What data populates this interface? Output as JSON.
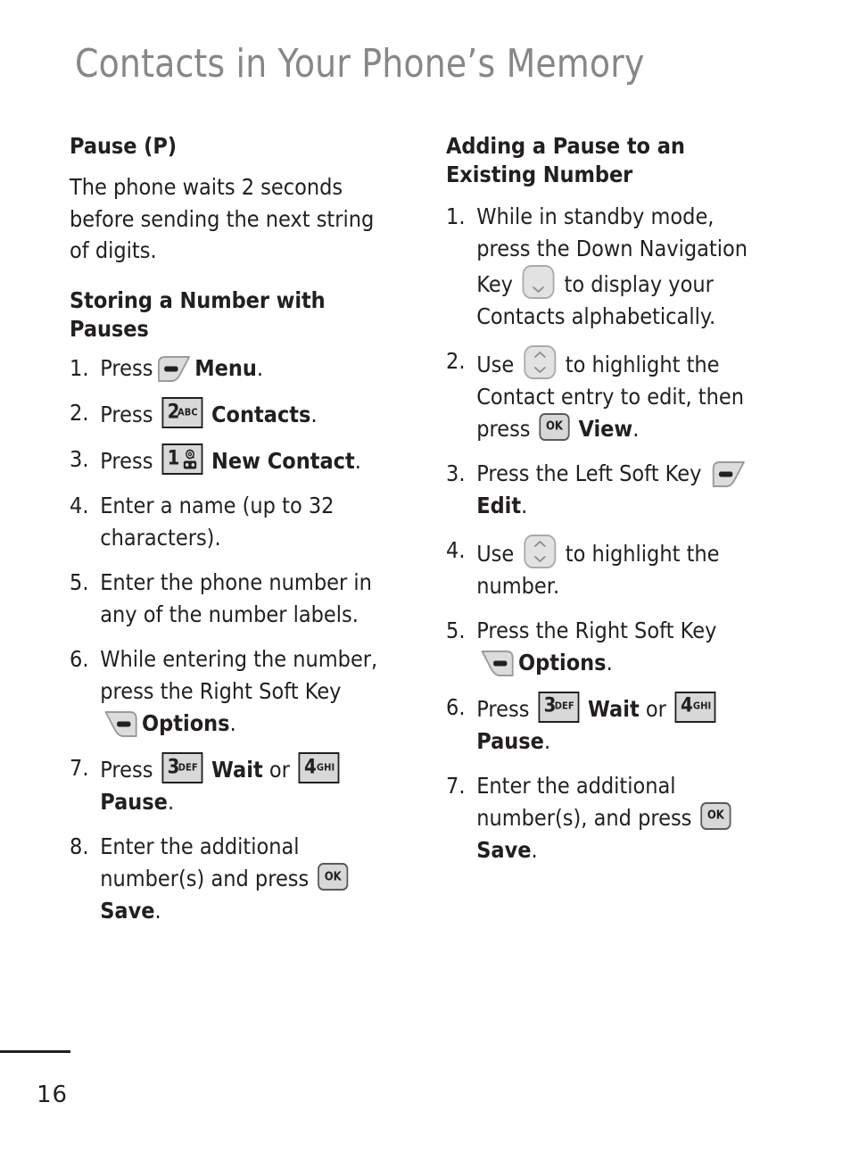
{
  "page": {
    "title": "Contacts in Your Phone’s Memory",
    "number": "16",
    "title_color": "#878787",
    "text_color": "#231f20"
  },
  "left_column": {
    "heading_1": "Pause (P)",
    "paragraph_1": "The phone waits 2 seconds before sending the next string of digits.",
    "heading_2": "Storing a Number with Pauses",
    "steps": [
      {
        "num": "1.",
        "pre": "Press",
        "icon": "left-soft-key",
        "bold": "Menu",
        "post": "."
      },
      {
        "num": "2.",
        "pre": "Press",
        "icon": "key-2-abc",
        "bold": "Contacts",
        "post": "."
      },
      {
        "num": "3.",
        "pre": "Press",
        "icon": "key-1-voicemail",
        "bold": "New Contact",
        "post": "."
      },
      {
        "num": "4.",
        "pre": "Enter a name (up to 32 characters)."
      },
      {
        "num": "5.",
        "pre": "Enter the phone number in any of the number labels."
      },
      {
        "num": "6.",
        "pre": "While entering the number, press the Right Soft Key",
        "icon": "right-soft-key",
        "bold": "Options",
        "post": "."
      },
      {
        "num": "7.",
        "pre": "Press",
        "icon": "key-3-def",
        "bold": "Wait",
        "mid": "or",
        "icon2": "key-4-ghi",
        "bold2": "Pause",
        "post": "."
      },
      {
        "num": "8.",
        "pre": "Enter the additional number(s) and press",
        "icon": "ok-key",
        "bold": "Save",
        "post": "."
      }
    ]
  },
  "right_column": {
    "heading_1": "Adding a Pause to an Existing Number",
    "steps": [
      {
        "num": "1.",
        "pre": "While in standby mode, press the Down Navigation Key",
        "icon": "down-navigation-key",
        "post": "to display your Contacts alphabetically."
      },
      {
        "num": "2.",
        "pre": "Use",
        "icon": "up-down-navigation-key",
        "mid": "to highlight the Contact entry to edit, then press",
        "icon2": "ok-key",
        "bold2": "View",
        "post": "."
      },
      {
        "num": "3.",
        "pre": "Press the Left Soft Key",
        "icon": "left-soft-key",
        "bold": "Edit",
        "post": "."
      },
      {
        "num": "4.",
        "pre": "Use",
        "icon": "up-down-navigation-key",
        "mid": "to highlight the number."
      },
      {
        "num": "5.",
        "pre": "Press the Right Soft Key",
        "icon": "right-soft-key",
        "bold": "Options",
        "post": "."
      },
      {
        "num": "6.",
        "pre": "Press",
        "icon": "key-3-def",
        "bold": "Wait",
        "mid": "or",
        "icon2": "key-4-ghi",
        "bold2": "Pause",
        "post": "."
      },
      {
        "num": "7.",
        "pre": "Enter the additional number(s), and press",
        "icon": "ok-key",
        "bold": "Save",
        "post": "."
      }
    ]
  },
  "keys": {
    "k1": {
      "digit": "1",
      "letters": ""
    },
    "k2": {
      "digit": "2",
      "letters": "ABC"
    },
    "k3": {
      "digit": "3",
      "letters": "DEF"
    },
    "k4": {
      "digit": "4",
      "letters": "GHI"
    },
    "ok": {
      "label": "OK"
    }
  }
}
